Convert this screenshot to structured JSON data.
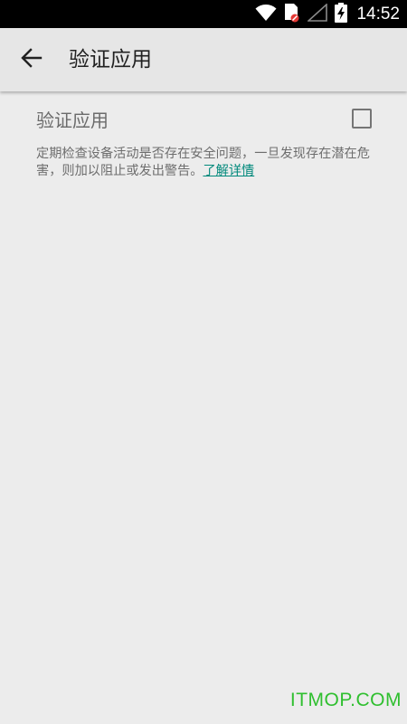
{
  "status_bar": {
    "time": "14:52",
    "icons": [
      "wifi-icon",
      "sim-card-icon",
      "signal-icon",
      "battery-charging-icon"
    ]
  },
  "app_bar": {
    "back_icon": "arrow-left-icon",
    "title": "验证应用"
  },
  "setting": {
    "title": "验证应用",
    "checked": false,
    "description": "定期检查设备活动是否存在安全问题，一旦发现存在潜在危害，则加以阻止或发出警告。",
    "learn_more": "了解详情"
  },
  "watermark": "ITMOP.COM",
  "colors": {
    "status_bar": "#000000",
    "app_bar": "#e6e6e6",
    "background": "#ececec",
    "link": "#00897b",
    "watermark": "#2fbf2f"
  }
}
